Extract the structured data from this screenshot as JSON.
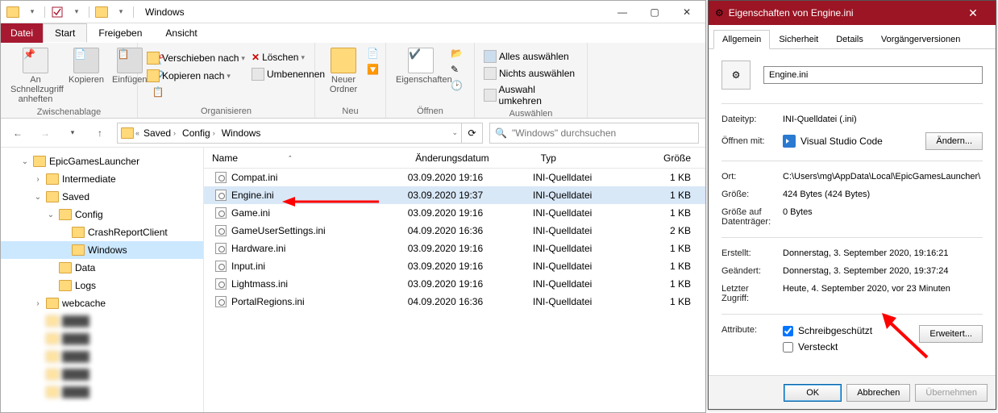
{
  "titlebar": {
    "title": "Windows"
  },
  "tabs": {
    "file": "Datei",
    "start": "Start",
    "share": "Freigeben",
    "view": "Ansicht"
  },
  "ribbon": {
    "clipboard": {
      "label": "Zwischenablage",
      "pin": "An Schnellzugriff\nanheften",
      "copy": "Kopieren",
      "paste": "Einfügen"
    },
    "organize": {
      "label": "Organisieren",
      "move": "Verschieben nach",
      "copyto": "Kopieren nach",
      "delete": "Löschen",
      "rename": "Umbenennen"
    },
    "new": {
      "label": "Neu",
      "folder": "Neuer\nOrdner"
    },
    "open": {
      "label": "Öffnen",
      "props": "Eigenschaften"
    },
    "select": {
      "label": "Auswählen",
      "all": "Alles auswählen",
      "none": "Nichts auswählen",
      "invert": "Auswahl umkehren"
    }
  },
  "breadcrumbs": [
    "Saved",
    "Config",
    "Windows"
  ],
  "search": {
    "placeholder": "\"Windows\" durchsuchen"
  },
  "tree": [
    {
      "depth": 1,
      "twisty": "v",
      "label": "EpicGamesLauncher"
    },
    {
      "depth": 2,
      "twisty": ">",
      "label": "Intermediate"
    },
    {
      "depth": 2,
      "twisty": "v",
      "label": "Saved"
    },
    {
      "depth": 3,
      "twisty": "v",
      "label": "Config"
    },
    {
      "depth": 4,
      "twisty": "",
      "label": "CrashReportClient"
    },
    {
      "depth": 4,
      "twisty": "",
      "label": "Windows",
      "sel": true
    },
    {
      "depth": 3,
      "twisty": "",
      "label": "Data"
    },
    {
      "depth": 3,
      "twisty": "",
      "label": "Logs"
    },
    {
      "depth": 2,
      "twisty": ">",
      "label": "webcache"
    }
  ],
  "columns": {
    "name": "Name",
    "date": "Änderungsdatum",
    "type": "Typ",
    "size": "Größe"
  },
  "files": [
    {
      "name": "Compat.ini",
      "date": "03.09.2020 19:16",
      "type": "INI-Quelldatei",
      "size": "1 KB"
    },
    {
      "name": "Engine.ini",
      "date": "03.09.2020 19:37",
      "type": "INI-Quelldatei",
      "size": "1 KB",
      "sel": true
    },
    {
      "name": "Game.ini",
      "date": "03.09.2020 19:16",
      "type": "INI-Quelldatei",
      "size": "1 KB"
    },
    {
      "name": "GameUserSettings.ini",
      "date": "04.09.2020 16:36",
      "type": "INI-Quelldatei",
      "size": "2 KB"
    },
    {
      "name": "Hardware.ini",
      "date": "03.09.2020 19:16",
      "type": "INI-Quelldatei",
      "size": "1 KB"
    },
    {
      "name": "Input.ini",
      "date": "03.09.2020 19:16",
      "type": "INI-Quelldatei",
      "size": "1 KB"
    },
    {
      "name": "Lightmass.ini",
      "date": "03.09.2020 19:16",
      "type": "INI-Quelldatei",
      "size": "1 KB"
    },
    {
      "name": "PortalRegions.ini",
      "date": "04.09.2020 16:36",
      "type": "INI-Quelldatei",
      "size": "1 KB"
    }
  ],
  "props": {
    "title": "Eigenschaften von Engine.ini",
    "tabs": [
      "Allgemein",
      "Sicherheit",
      "Details",
      "Vorgängerversionen"
    ],
    "filename": "Engine.ini",
    "rows": {
      "type_l": "Dateityp:",
      "type_v": "INI-Quelldatei (.ini)",
      "open_l": "Öffnen mit:",
      "open_v": "Visual Studio Code",
      "open_btn": "Ändern...",
      "loc_l": "Ort:",
      "loc_v": "C:\\Users\\mg\\AppData\\Local\\EpicGamesLauncher\\",
      "size_l": "Größe:",
      "size_v": "424 Bytes (424 Bytes)",
      "disk_l": "Größe auf Datenträger:",
      "disk_v": "0 Bytes",
      "created_l": "Erstellt:",
      "created_v": "Donnerstag, 3. September 2020, 19:16:21",
      "modified_l": "Geändert:",
      "modified_v": "Donnerstag, 3. September 2020, 19:37:24",
      "access_l": "Letzter Zugriff:",
      "access_v": "Heute, 4. September 2020, vor 23 Minuten",
      "attr_l": "Attribute:",
      "attr_ro": "Schreibgeschützt",
      "attr_hidden": "Versteckt",
      "adv_btn": "Erweitert..."
    },
    "footer": {
      "ok": "OK",
      "cancel": "Abbrechen",
      "apply": "Übernehmen"
    }
  }
}
